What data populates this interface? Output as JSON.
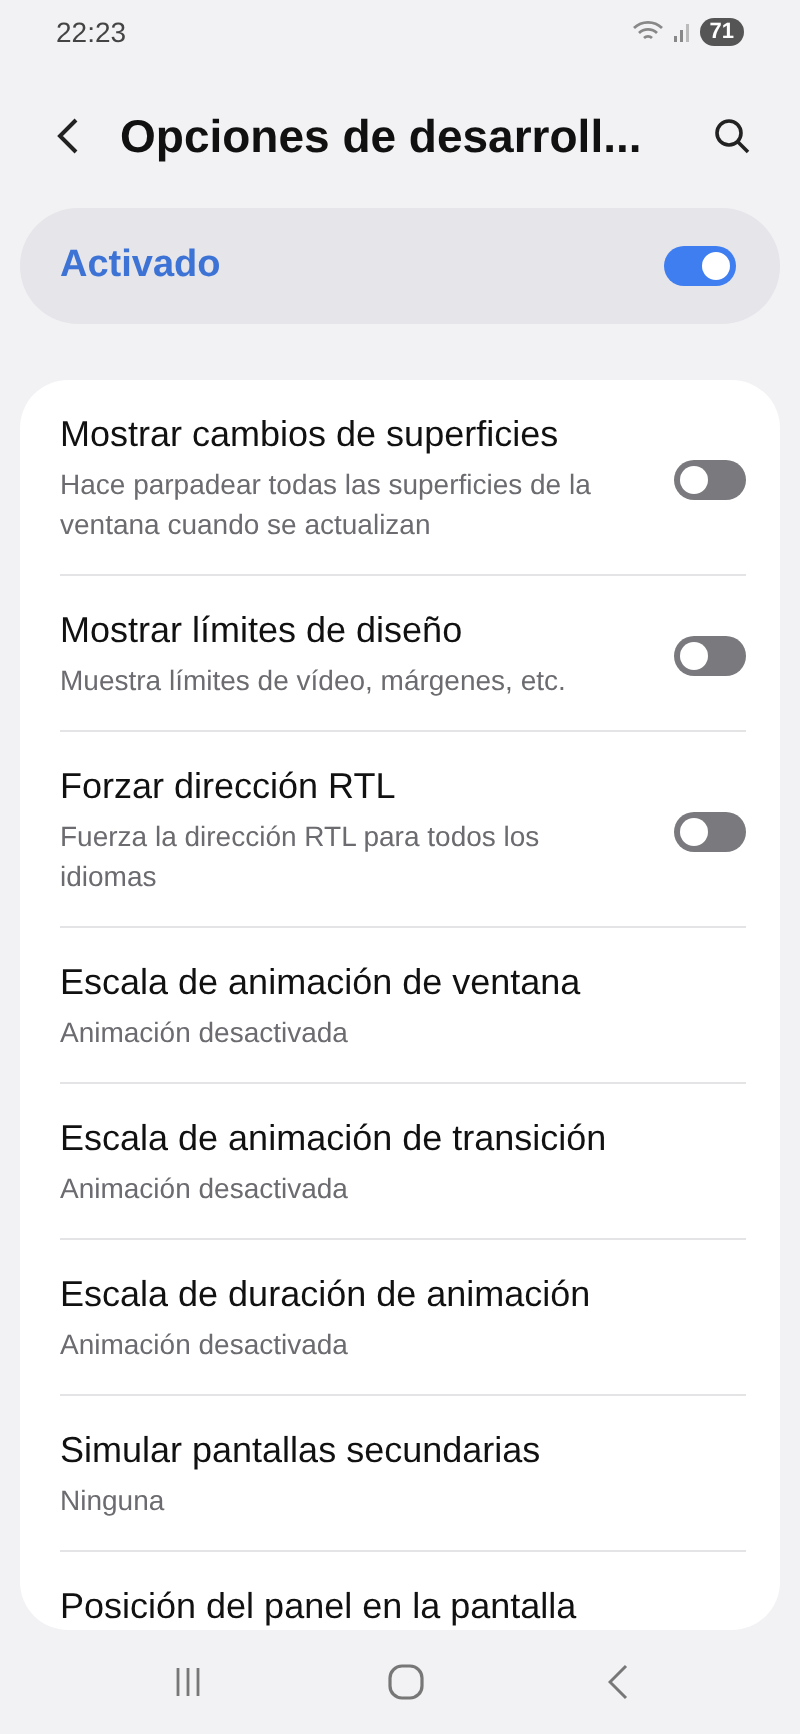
{
  "status_bar": {
    "time": "22:23",
    "battery": "71"
  },
  "header": {
    "title": "Opciones de desarroll..."
  },
  "master_switch": {
    "label": "Activado",
    "on": true
  },
  "settings": [
    {
      "kind": "switch",
      "title": "Mostrar cambios de superficies",
      "subtitle": "Hace parpadear todas las superficies de la ventana cuando se actualizan",
      "on": false
    },
    {
      "kind": "switch",
      "title": "Mostrar límites de diseño",
      "subtitle": "Muestra límites de vídeo, márgenes, etc.",
      "on": false
    },
    {
      "kind": "switch",
      "title": "Forzar dirección RTL",
      "subtitle": "Fuerza la dirección RTL para todos los idiomas",
      "on": false
    },
    {
      "kind": "value",
      "title": "Escala de animación de ventana",
      "subtitle": "Animación desactivada"
    },
    {
      "kind": "value",
      "title": "Escala de animación de transición",
      "subtitle": "Animación desactivada"
    },
    {
      "kind": "value",
      "title": "Escala de duración de animación",
      "subtitle": "Animación desactivada"
    },
    {
      "kind": "value",
      "title": "Simular pantallas secundarias",
      "subtitle": "Ninguna"
    },
    {
      "kind": "value",
      "title": "Posición del panel en la pantalla"
    }
  ]
}
